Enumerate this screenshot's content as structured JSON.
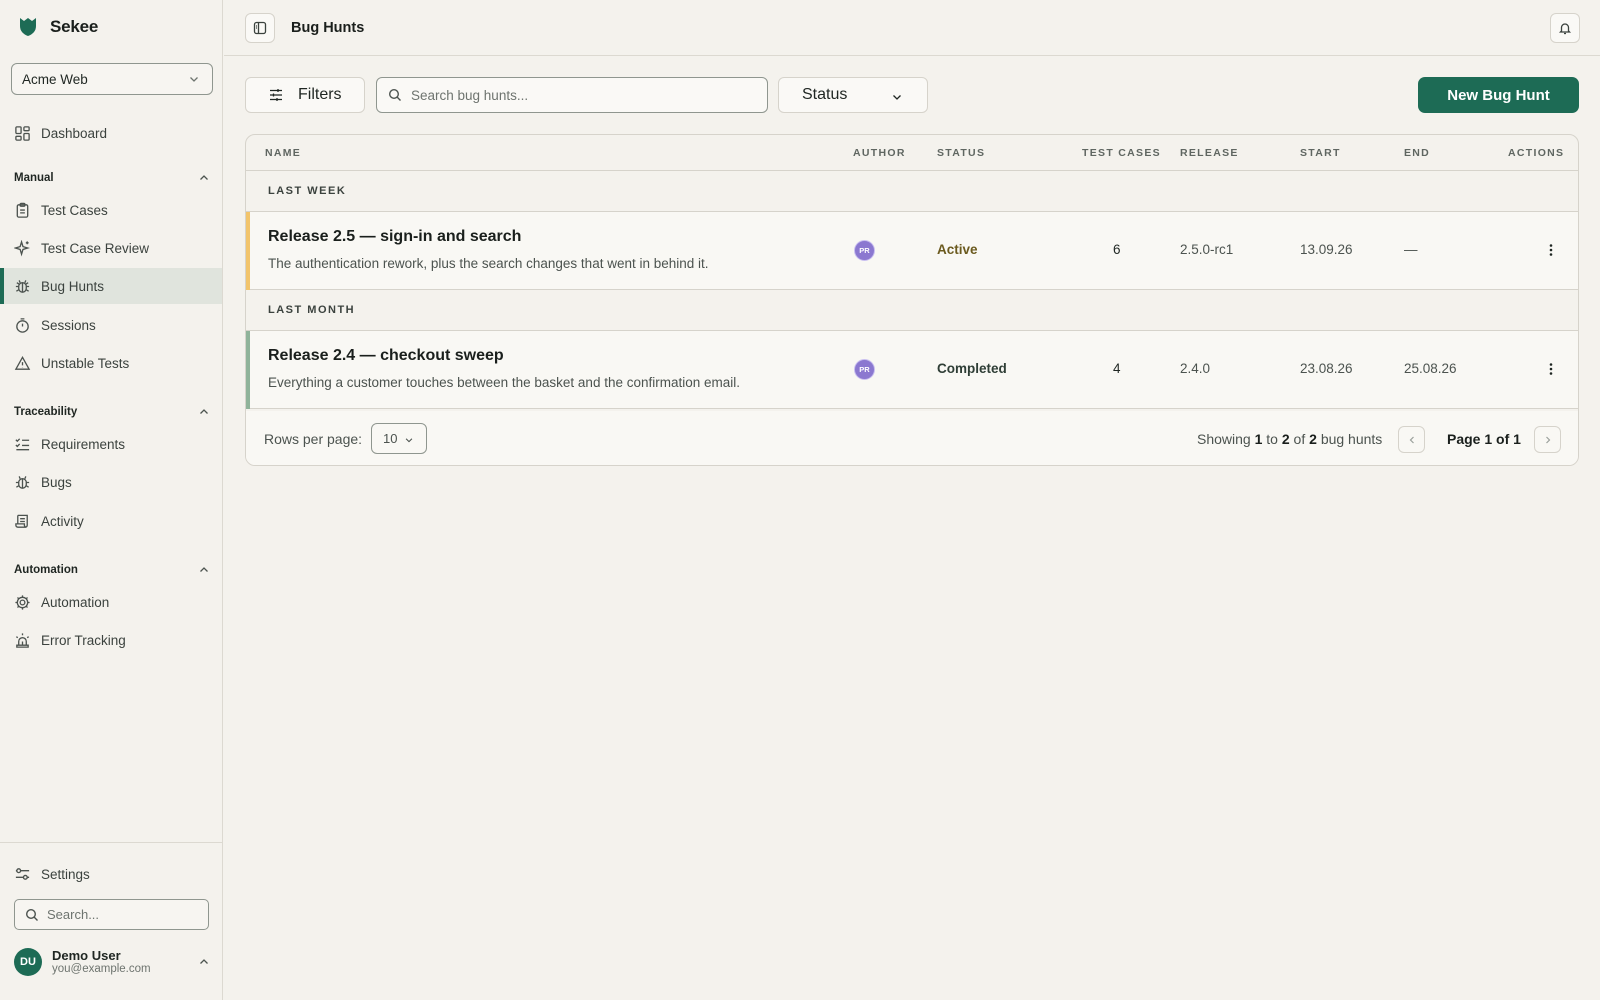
{
  "brand": {
    "name": "Sekee",
    "accent": "#1d6b55"
  },
  "project": {
    "selected": "Acme Web"
  },
  "sidebar": {
    "dashboard": "Dashboard",
    "sections": [
      {
        "title": "Manual",
        "items": [
          "Test Cases",
          "Test Case Review",
          "Bug Hunts",
          "Sessions",
          "Unstable Tests"
        ]
      },
      {
        "title": "Traceability",
        "items": [
          "Requirements",
          "Bugs",
          "Activity"
        ]
      },
      {
        "title": "Automation",
        "items": [
          "Automation",
          "Error Tracking"
        ]
      }
    ],
    "active_item": "Bug Hunts",
    "settings": "Settings",
    "search_placeholder": "Search...",
    "user": {
      "initials": "DU",
      "name": "Demo User",
      "email": "you@example.com"
    }
  },
  "header": {
    "title": "Bug Hunts"
  },
  "toolbar": {
    "filters_label": "Filters",
    "search_placeholder": "Search bug hunts...",
    "status_label": "Status",
    "new_label": "New Bug Hunt"
  },
  "table": {
    "columns": [
      "NAME",
      "AUTHOR",
      "STATUS",
      "TEST CASES",
      "RELEASE",
      "START",
      "END",
      "ACTIONS"
    ],
    "groups": [
      {
        "label": "LAST WEEK",
        "rows": [
          {
            "title": "Release 2.5 — sign-in and search",
            "description": "The authentication rework, plus the search changes that went in behind it.",
            "author": "PR",
            "status": "Active",
            "status_color": "#f2c46b",
            "test_cases": "6",
            "release": "2.5.0-rc1",
            "start": "13.09.26",
            "end": "—"
          }
        ]
      },
      {
        "label": "LAST MONTH",
        "rows": [
          {
            "title": "Release 2.4 — checkout sweep",
            "description": "Everything a customer touches between the basket and the confirmation email.",
            "author": "PR",
            "status": "Completed",
            "status_color": "#8fb39a",
            "test_cases": "4",
            "release": "2.4.0",
            "start": "23.08.26",
            "end": "25.08.26"
          }
        ]
      }
    ]
  },
  "pagination": {
    "rows_label": "Rows per page:",
    "rows_value": "10",
    "showing_prefix": "Showing",
    "from": "1",
    "to_word": "to",
    "to": "2",
    "of_word": "of",
    "total": "2",
    "suffix": "bug hunts",
    "page_label": "Page 1 of 1"
  }
}
